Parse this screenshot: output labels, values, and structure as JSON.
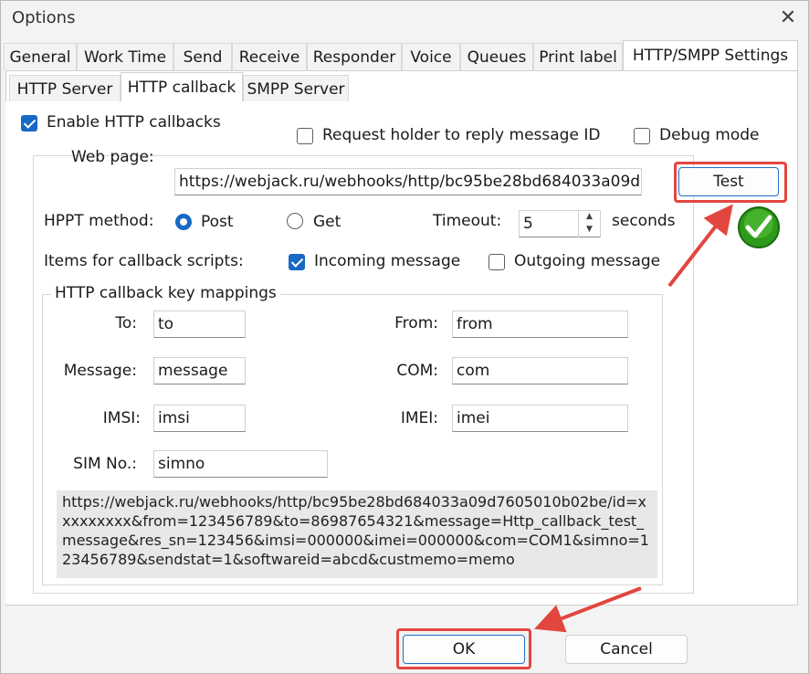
{
  "window": {
    "title": "Options"
  },
  "main_tabs": [
    {
      "label": "General"
    },
    {
      "label": "Work Time"
    },
    {
      "label": "Send"
    },
    {
      "label": "Receive"
    },
    {
      "label": "Responder"
    },
    {
      "label": "Voice"
    },
    {
      "label": "Queues"
    },
    {
      "label": "Print label"
    },
    {
      "label": "HTTP/SMPP Settings"
    }
  ],
  "sub_tabs": [
    {
      "label": "HTTP Server"
    },
    {
      "label": "HTTP callback"
    },
    {
      "label": "SMPP Server"
    }
  ],
  "options": {
    "enable_callbacks": {
      "label": "Enable HTTP callbacks",
      "checked": true
    },
    "request_holder": {
      "label": "Request holder to reply message ID",
      "checked": false
    },
    "debug_mode": {
      "label": "Debug mode",
      "checked": false
    }
  },
  "web_page": {
    "label": "Web page:",
    "value": "https://webjack.ru/webhooks/http/bc95be28bd684033a09d"
  },
  "test_button": {
    "label": "Test"
  },
  "method": {
    "label": "HPPT method:",
    "post": "Post",
    "get": "Get",
    "selected": "Post"
  },
  "timeout": {
    "label": "Timeout:",
    "value": "5",
    "unit": "seconds"
  },
  "items": {
    "label": "Items for callback scripts:",
    "incoming": "Incoming message",
    "outgoing": "Outgoing message",
    "incoming_checked": true,
    "outgoing_checked": false
  },
  "mappings": {
    "legend": "HTTP callback key mappings",
    "to": {
      "label": "To:",
      "value": "to"
    },
    "from": {
      "label": "From:",
      "value": "from"
    },
    "message": {
      "label": "Message:",
      "value": "message"
    },
    "com": {
      "label": "COM:",
      "value": "com"
    },
    "imsi": {
      "label": "IMSI:",
      "value": "imsi"
    },
    "imei": {
      "label": "IMEI:",
      "value": "imei"
    },
    "simno": {
      "label": "SIM No.:",
      "value": "simno"
    }
  },
  "preview_url": "https://webjack.ru/webhooks/http/bc95be28bd684033a09d7605010b02be/id=xxxxxxxxx&from=123456789&to=86987654321&message=Http_callback_test_message&res_sn=123456&imsi=000000&imei=000000&com=COM1&simno=123456789&sendstat=1&softwareid=abcd&custmemo=memo",
  "footer": {
    "ok": "OK",
    "cancel": "Cancel"
  },
  "colors": {
    "accent": "#1869c4",
    "highlight": "#e2463f",
    "success": "#2d9a1b"
  }
}
